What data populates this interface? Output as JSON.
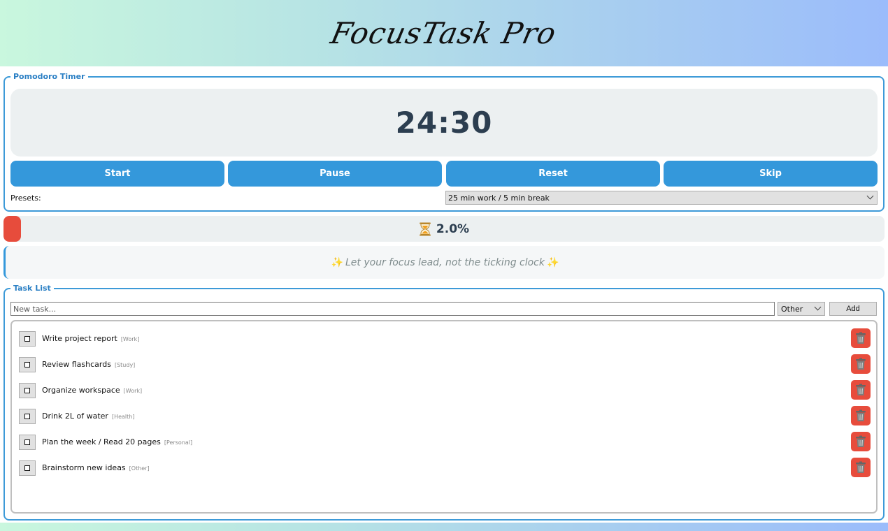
{
  "app": {
    "title": "FocusTask Pro"
  },
  "timer": {
    "group_label": "Pomodoro Timer",
    "display": "24:30",
    "buttons": {
      "start": "Start",
      "pause": "Pause",
      "reset": "Reset",
      "skip": "Skip"
    },
    "presets_label": "Presets:",
    "preset_selected": "25 min work / 5 min break"
  },
  "progress": {
    "label": "2.0%",
    "fraction": 0.02,
    "fill_color": "#e74c3c"
  },
  "quote": {
    "text": "Let your focus lead, not the ticking clock"
  },
  "tasks": {
    "group_label": "Task List",
    "input_placeholder": "New task...",
    "category_selected": "Other",
    "add_label": "Add",
    "items": [
      {
        "title": "Write project report",
        "category": "[Work]"
      },
      {
        "title": "Review flashcards",
        "category": "[Study]"
      },
      {
        "title": "Organize workspace",
        "category": "[Work]"
      },
      {
        "title": "Drink 2L of water",
        "category": "[Health]"
      },
      {
        "title": "Plan the week / Read 20 pages",
        "category": "[Personal]"
      },
      {
        "title": "Brainstorm new ideas",
        "category": "[Other]"
      }
    ]
  },
  "colors": {
    "accent": "#3498db",
    "danger": "#e74c3c",
    "timer_text": "#2c3e50",
    "panel_bg": "#ecf0f1"
  },
  "icons": {
    "progress": "hourglass-icon",
    "quote": "sparkle-icon",
    "delete": "trash-icon",
    "checkbox": "checkbox-icon"
  }
}
